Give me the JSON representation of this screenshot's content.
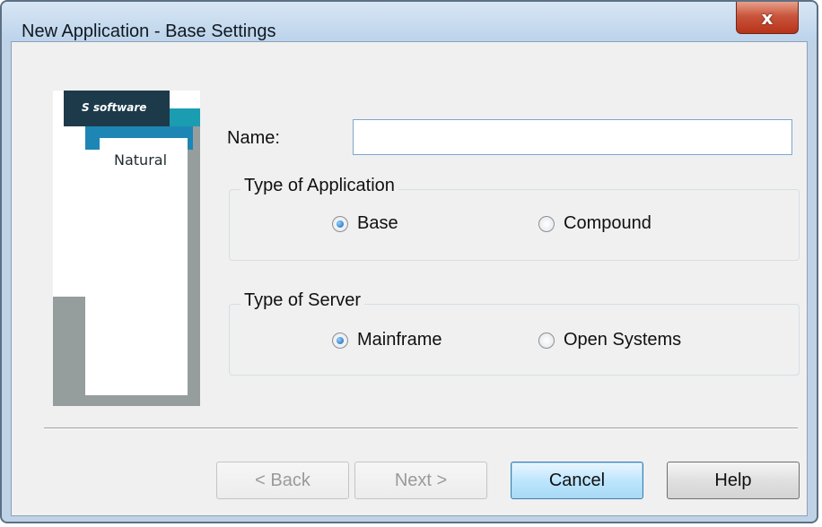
{
  "window": {
    "title": "New Application - Base Settings",
    "close_glyph": "x"
  },
  "logo": {
    "brand": "software",
    "brand_mark": "S",
    "product": "Natural"
  },
  "form": {
    "name_label": "Name:",
    "name_value": "",
    "app_type": {
      "title": "Type of Application",
      "options": [
        {
          "label": "Base",
          "checked": true
        },
        {
          "label": "Compound",
          "checked": false
        }
      ]
    },
    "server_type": {
      "title": "Type of Server",
      "options": [
        {
          "label": "Mainframe",
          "checked": true
        },
        {
          "label": "Open Systems",
          "checked": false
        }
      ]
    }
  },
  "buttons": {
    "back": "< Back",
    "next": "Next >",
    "cancel": "Cancel",
    "help": "Help"
  }
}
